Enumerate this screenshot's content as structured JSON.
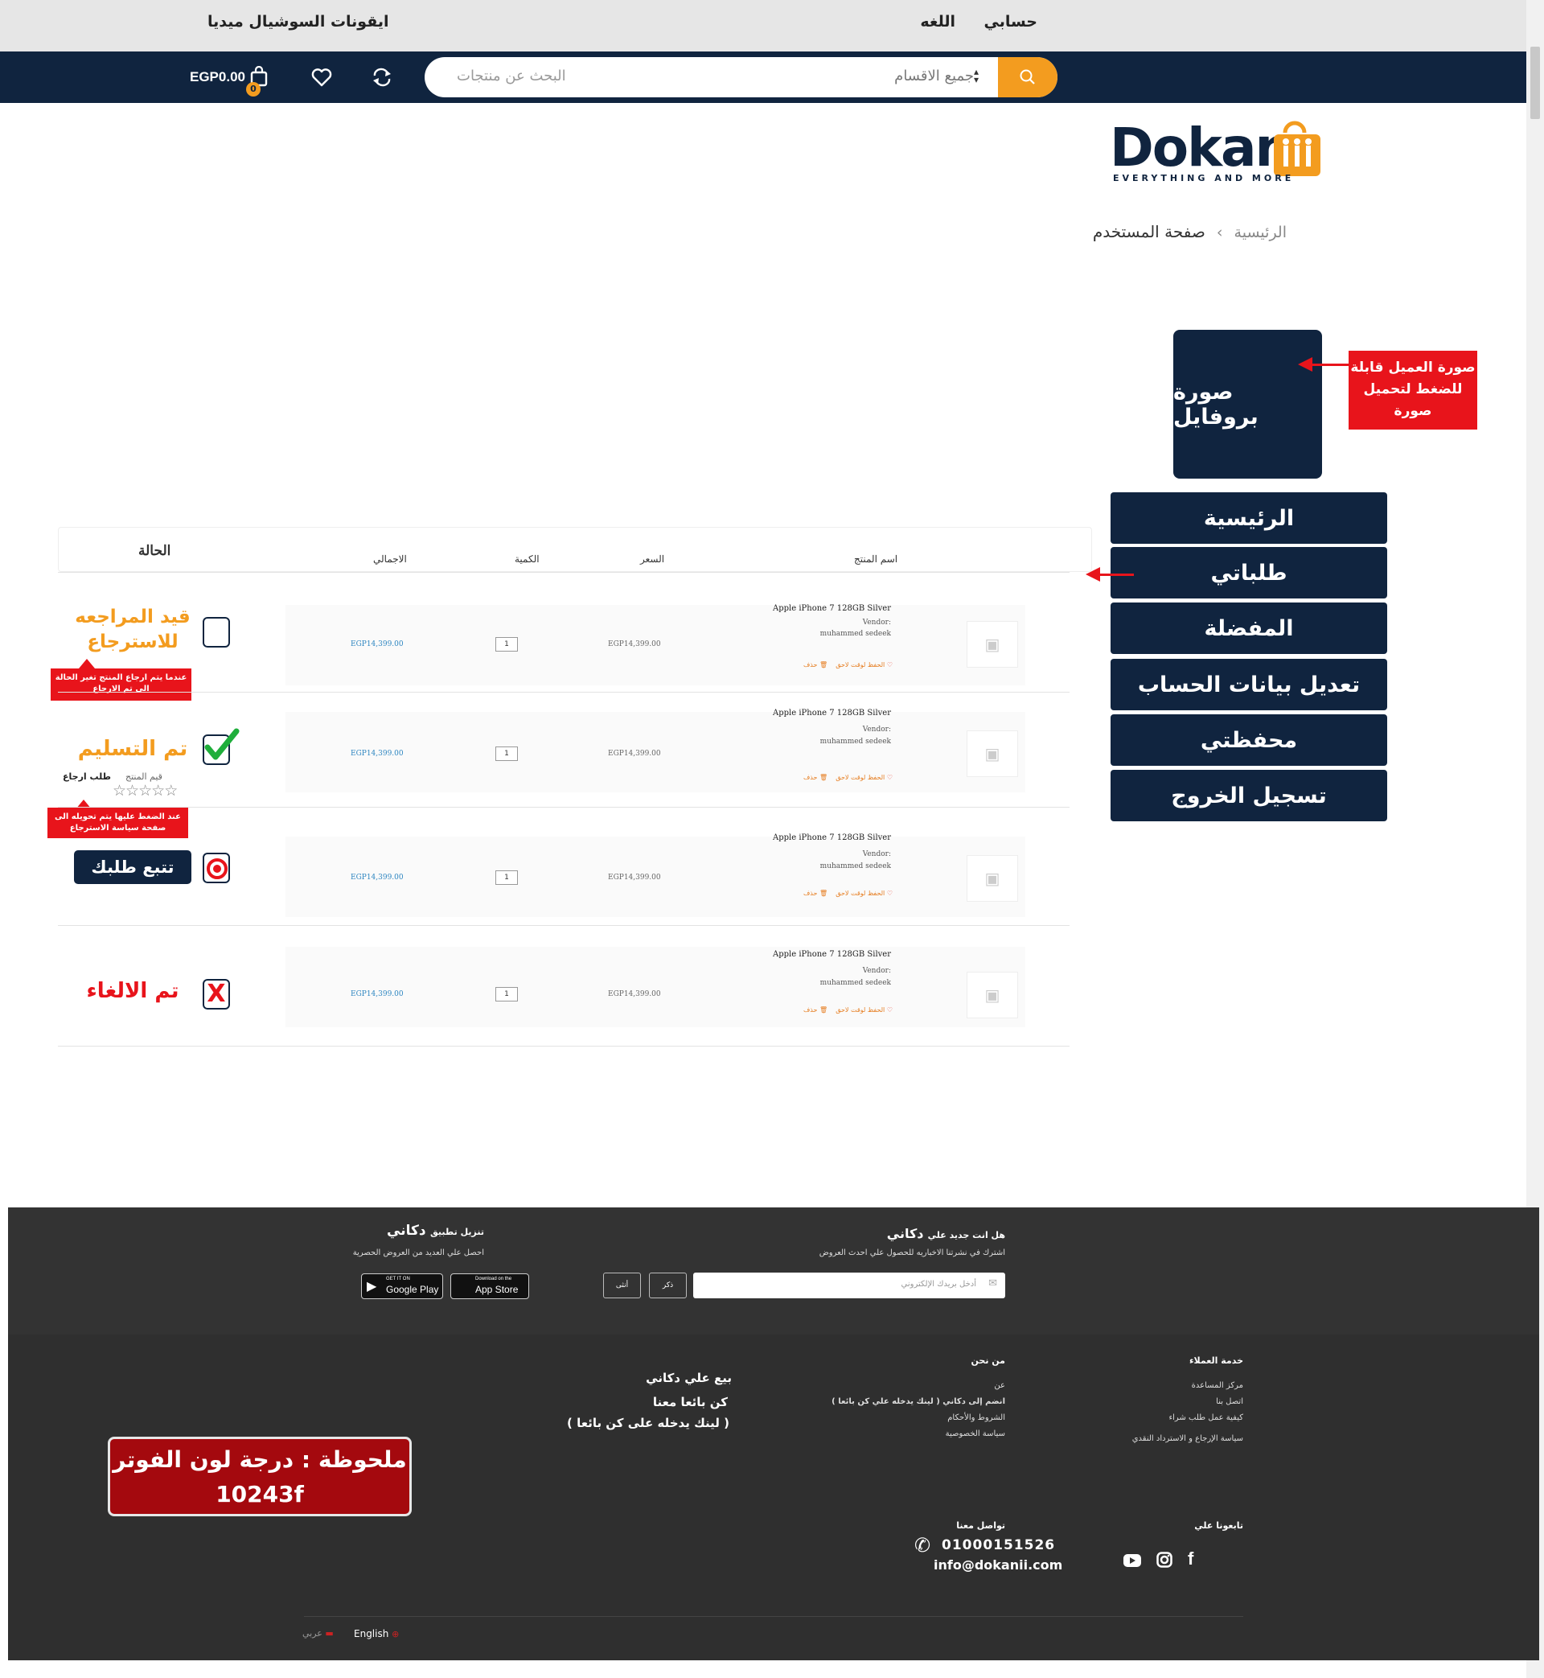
{
  "topbar": {
    "account": "حسابي",
    "language": "اللغه",
    "social_note": "ايقونات السوشيال ميديا"
  },
  "navbar": {
    "search_placeholder": "البحث عن منتجات",
    "category_select": "جميع الاقسام",
    "cart_amount": "EGP0.00",
    "cart_count": "0",
    "icons": [
      "search-icon",
      "cart-icon",
      "heart-icon",
      "compare-icon"
    ]
  },
  "logo": {
    "text": "Dokan",
    "tagline": "EVERYTHING AND MORE"
  },
  "breadcrumb": {
    "home": "الرئيسية",
    "separator": "›",
    "current": "صفحة المستخدم"
  },
  "profile": {
    "placeholder": "صورة بروفايل",
    "note": "صورة العميل قابلة للضغط لتحميل صورة"
  },
  "menu": [
    "الرئيسية",
    "طلباتي",
    "المفضلة",
    "تعديل بيانات الحساب",
    "محفظتي",
    "تسجيل الخروج"
  ],
  "table": {
    "headers": {
      "status": "الحالة",
      "total": "الاجمالي",
      "quantity": "الكمية",
      "price": "السعر",
      "product": "اسم المنتج"
    },
    "rows": [
      {
        "product": "Apple iPhone 7 128GB Silver",
        "vendor_label": "Vendor:",
        "vendor": "muhammed sedeek",
        "save_later": "الحفظ لوقت لاحق",
        "delete": "حذف",
        "price": "EGP14,399.00",
        "qty": "1",
        "total": "EGP14,399.00",
        "status": "قيد المراجعه للاسترجاع",
        "note": "عندما يتم ارجاع المنتج تغير الحالة الى تم الارجاع"
      },
      {
        "product": "Apple iPhone 7 128GB Silver",
        "vendor_label": "Vendor:",
        "vendor": "muhammed sedeek",
        "save_later": "الحفظ لوقت لاحق",
        "delete": "حذف",
        "price": "EGP14,399.00",
        "qty": "1",
        "total": "EGP14,399.00",
        "status": "تم التسليم",
        "rate_label": "قيم المنتج",
        "return_label": "طلب ارجاع",
        "note": "عند الضغط عليها يتم تحويله الى صفحة سياسة الاسترجاع"
      },
      {
        "product": "Apple iPhone 7 128GB Silver",
        "vendor_label": "Vendor:",
        "vendor": "muhammed sedeek",
        "save_later": "الحفظ لوقت لاحق",
        "delete": "حذف",
        "price": "EGP14,399.00",
        "qty": "1",
        "total": "EGP14,399.00",
        "status": "تتبع طلبك"
      },
      {
        "product": "Apple iPhone 7 128GB Silver",
        "vendor_label": "Vendor:",
        "vendor": "muhammed sedeek",
        "save_later": "الحفظ لوقت لاحق",
        "delete": "حذف",
        "price": "EGP14,399.00",
        "qty": "1",
        "total": "EGP14,399.00",
        "status": "تم الالغاء"
      }
    ]
  },
  "footer": {
    "newsletter_title": "هل انت جديد علي",
    "brand": "دكاني",
    "newsletter_sub": "اشترك في نشرتنا الاخباريه للحصول علي احدث العروض",
    "email_placeholder": "أدخل بريدك الإلكتروني",
    "male_btn": "ذكر",
    "female_btn": "أنثى",
    "app_title": "تنزيل تطبيق",
    "app_sub": "احصل علي العديد من العروض الحصرية",
    "google_small": "GET IT ON",
    "google_big": "Google Play",
    "apple_small": "Download on the",
    "apple_big": "App Store",
    "customer_service": {
      "title": "خدمة العملاء",
      "links": [
        "مركز المساعدة",
        "اتصل بنا",
        "كيفية عمل طلب شراء",
        "سياسة الإرجاع و الاسترداد النقدي"
      ]
    },
    "about": {
      "title": "من نحن",
      "links": [
        "عن",
        "انضم إلى  دكاني  ( لينك يدخله علي كن بائعا )",
        "الشروط والأحكام",
        "سياسة الخصوصية"
      ]
    },
    "sell": [
      "بيع علي دكاني",
      "كن بائعا معنا",
      "( لينك يدخله على كن بائعا )"
    ],
    "follow_title": "تابعونا علي",
    "contact_title": "تواصل معنا",
    "phone": "01000151526",
    "email": "info@dokanii.com",
    "note": "ملحوظة : درجة لون الفوتر 10243f",
    "lang_en": "English",
    "lang_ar": "عربي"
  },
  "colors": {
    "navy": "#10243f",
    "accent": "#f39c1f",
    "annotation_red": "#e8141b",
    "footer": "#333333"
  }
}
